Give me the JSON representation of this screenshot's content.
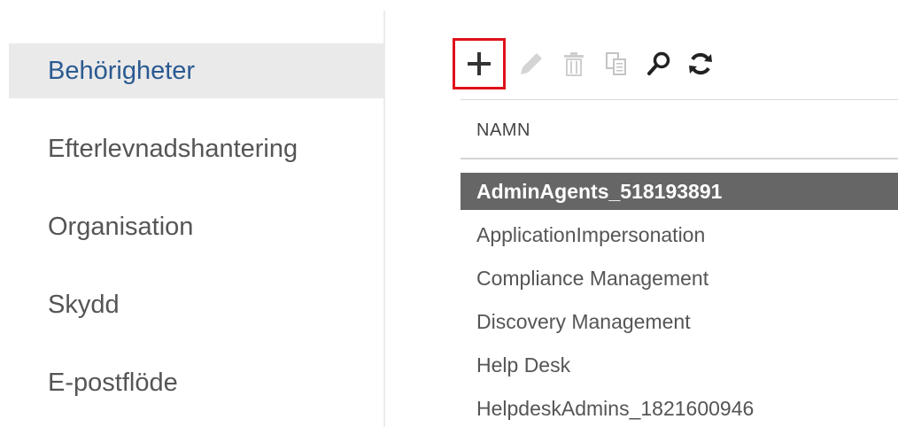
{
  "nav": {
    "items": [
      {
        "label": "Behörigheter",
        "active": true
      },
      {
        "label": "Efterlevnadshantering",
        "active": false
      },
      {
        "label": "Organisation",
        "active": false
      },
      {
        "label": "Skydd",
        "active": false
      },
      {
        "label": "E-postflöde",
        "active": false
      }
    ]
  },
  "toolbar": {
    "buttons": [
      {
        "icon": "plus-icon",
        "action": "new",
        "enabled": true,
        "highlighted": true
      },
      {
        "icon": "pencil-icon",
        "action": "edit",
        "enabled": false
      },
      {
        "icon": "trash-icon",
        "action": "delete",
        "enabled": false
      },
      {
        "icon": "copy-icon",
        "action": "copy",
        "enabled": false
      },
      {
        "icon": "search-icon",
        "action": "search",
        "enabled": true
      },
      {
        "icon": "refresh-icon",
        "action": "refresh",
        "enabled": true
      }
    ]
  },
  "list": {
    "column_header": "NAMN",
    "rows": [
      {
        "name": "AdminAgents_518193891",
        "selected": true
      },
      {
        "name": "ApplicationImpersonation",
        "selected": false
      },
      {
        "name": "Compliance Management",
        "selected": false
      },
      {
        "name": "Discovery Management",
        "selected": false
      },
      {
        "name": "Help Desk",
        "selected": false
      },
      {
        "name": "HelpdeskAdmins_1821600946",
        "selected": false
      }
    ]
  },
  "colors": {
    "accent": "#2a5a91",
    "highlight_border": "#e0101a",
    "selected_row": "#666666",
    "nav_active_bg": "#eaeaea",
    "enabled_icon": "#333333",
    "disabled_icon": "#cfcfcf"
  }
}
